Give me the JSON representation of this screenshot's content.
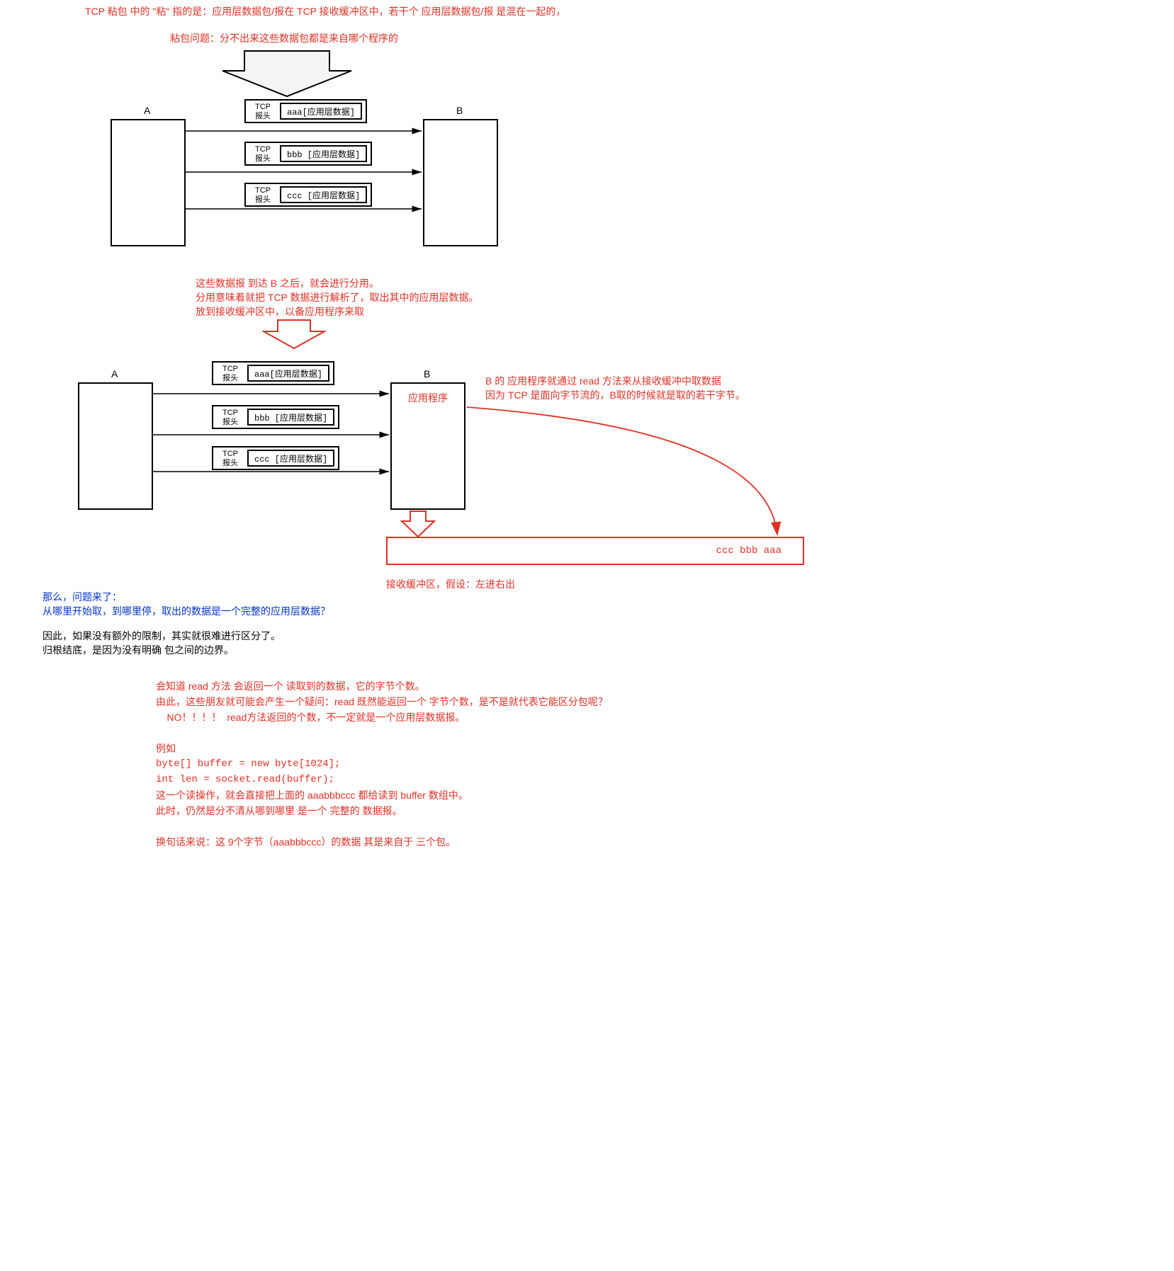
{
  "title1": "TCP 粘包 中的  \"粘\" 指的是：应用层数据包/报在 TCP 接收缓冲区中，若干个 应用层数据包/报 是混在一起的，",
  "title2": "粘包问题：分不出来这些数据包都是来自哪个程序的",
  "hosts": {
    "A": "A",
    "B": "B"
  },
  "tcpHeader": {
    "l1": "TCP",
    "l2": "报头"
  },
  "packets": {
    "a": "aaa[应用层数据]",
    "b": "bbb [应用层数据]",
    "c": "ccc [应用层数据]"
  },
  "midText": {
    "l1": "这些数据报 到达 B 之后，就会进行分用。",
    "l2": "分用意味着就把 TCP 数据进行解析了，取出其中的应用层数据。",
    "l3": "放到接收缓冲区中，以备应用程序来取"
  },
  "appLabel": "应用程序",
  "rightText": {
    "l1": "B 的 应用程序就通过 read 方法来从接收缓冲中取数据",
    "l2": "因为 TCP 是面向字节流的，B取的时候就是取的若干字节。"
  },
  "bufferContent": "ccc bbb aaa",
  "bufferCaption": "接收缓冲区，假设：左进右出",
  "question": {
    "l1": "那么，问题来了：",
    "l2": "从哪里开始取，到哪里停，取出的数据是一个完整的应用层数据？"
  },
  "concl": {
    "l1": "因此，如果没有额外的限制，其实就很难进行区分了。",
    "l2": "归根结底，是因为没有明确 包之间的边界。"
  },
  "bottom": {
    "l1": "会知道 read 方法 会返回一个 读取到的数据，它的字节个数。",
    "l2": "由此，这些朋友就可能会产生一个疑问：read 既然能返回一个 字节个数，是不是就代表它能区分包呢？",
    "l3": "    NO！！！！  read方法返回的个数，不一定就是一个应用层数据报。",
    "l4": "",
    "l5": "例如",
    "l6": "byte[] buffer = new byte[1024];",
    "l7": "int len = socket.read(buffer);",
    "l8": "这一个读操作，就会直接把上面的 aaabbbccc 都给读到 buffer 数组中。",
    "l9": "此时，仍然是分不清从哪到哪里 是一个 完整的 数据报。",
    "l10": "",
    "l11": "换句话来说：这 9个字节（aaabbbccc）的数据 其是来自于 三个包。"
  }
}
